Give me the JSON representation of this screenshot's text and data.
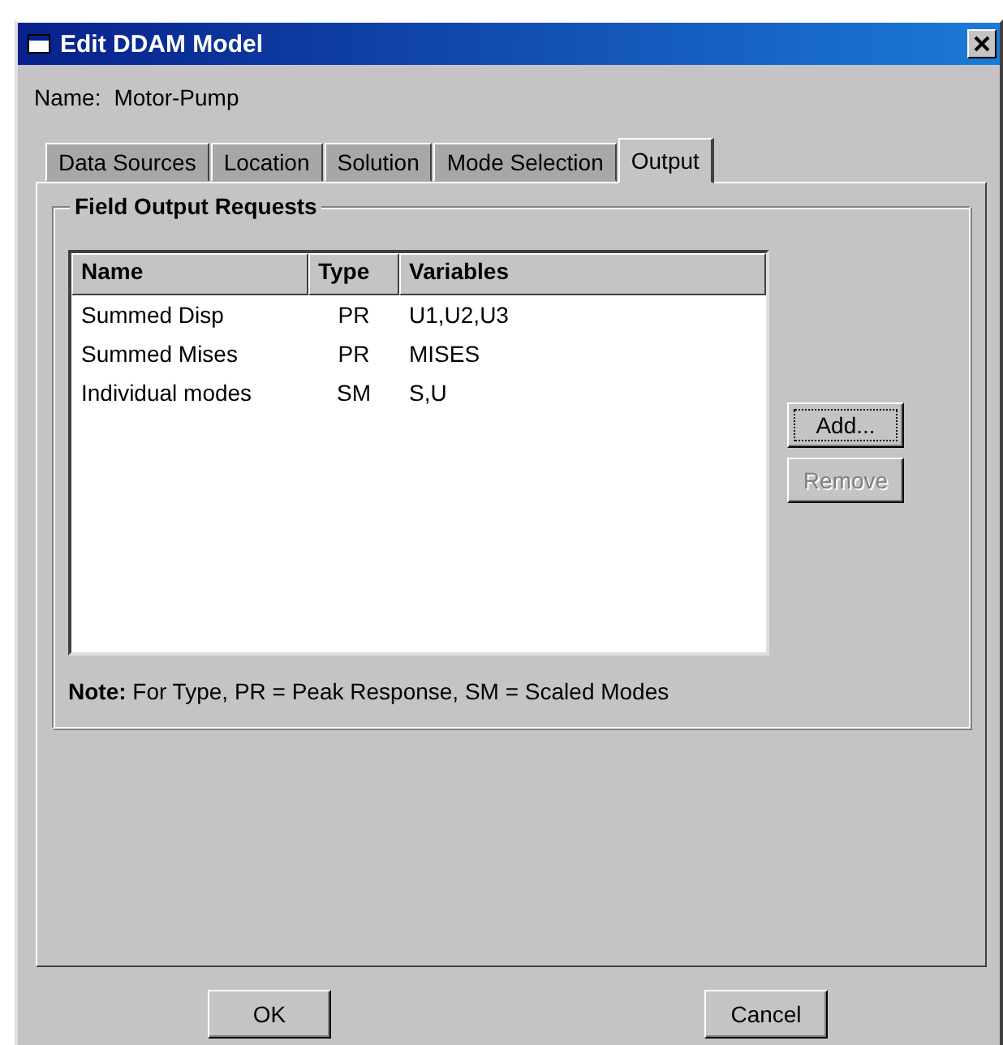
{
  "window": {
    "title": "Edit DDAM Model"
  },
  "name_field": {
    "label": "Name:",
    "value": "Motor-Pump"
  },
  "tabs": [
    {
      "label": "Data Sources",
      "selected": false
    },
    {
      "label": "Location",
      "selected": false
    },
    {
      "label": "Solution",
      "selected": false
    },
    {
      "label": "Mode Selection",
      "selected": false
    },
    {
      "label": "Output",
      "selected": true
    }
  ],
  "group": {
    "title": "Field Output Requests"
  },
  "table": {
    "columns": [
      "Name",
      "Type",
      "Variables"
    ],
    "rows": [
      [
        "Summed Disp",
        "PR",
        "U1,U2,U3"
      ],
      [
        "Summed Mises",
        "PR",
        "MISES"
      ],
      [
        "Individual modes",
        "SM",
        "S,U"
      ]
    ]
  },
  "side_buttons": [
    {
      "label": "Add...",
      "disabled": false,
      "focused": true
    },
    {
      "label": "Remove",
      "disabled": true,
      "focused": false
    }
  ],
  "note": "**Note:**  For Type, PR = Peak Response, SM = Scaled Modes",
  "buttons": [
    "OK",
    "Cancel"
  ]
}
